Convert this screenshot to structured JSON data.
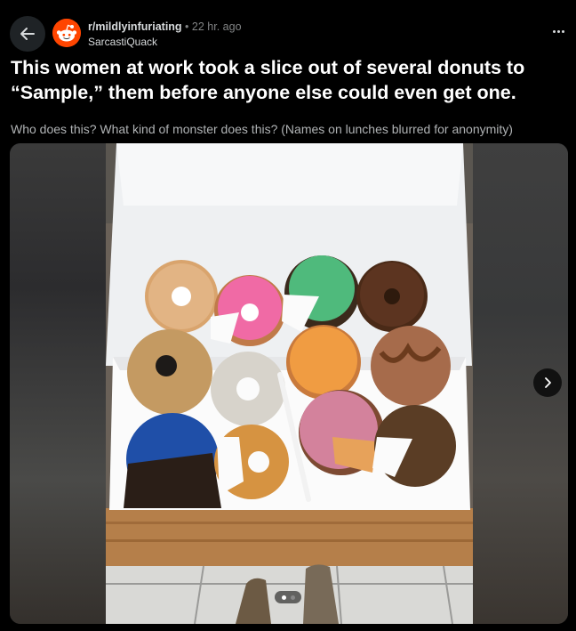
{
  "post": {
    "subreddit": "r/mildlyinfuriating",
    "separator": "•",
    "time": "22 hr. ago",
    "author": "SarcastiQuack",
    "title": "This women at work took a slice out of several donuts to “Sample,” them before anyone else could even get one.",
    "body": "Who does this? What kind of monster does this? (Names on lunches blurred for anonymity)"
  },
  "icons": {
    "back": "arrow-left-icon",
    "avatar": "reddit-snoo-avatar",
    "more": "more-horizontal-icon",
    "next": "chevron-right-icon"
  },
  "gallery": {
    "current_page": 1,
    "total_pages": 2
  },
  "colors": {
    "background": "#000000",
    "title": "#ffffff",
    "meta": "#818384",
    "accent": "#ff4500"
  }
}
